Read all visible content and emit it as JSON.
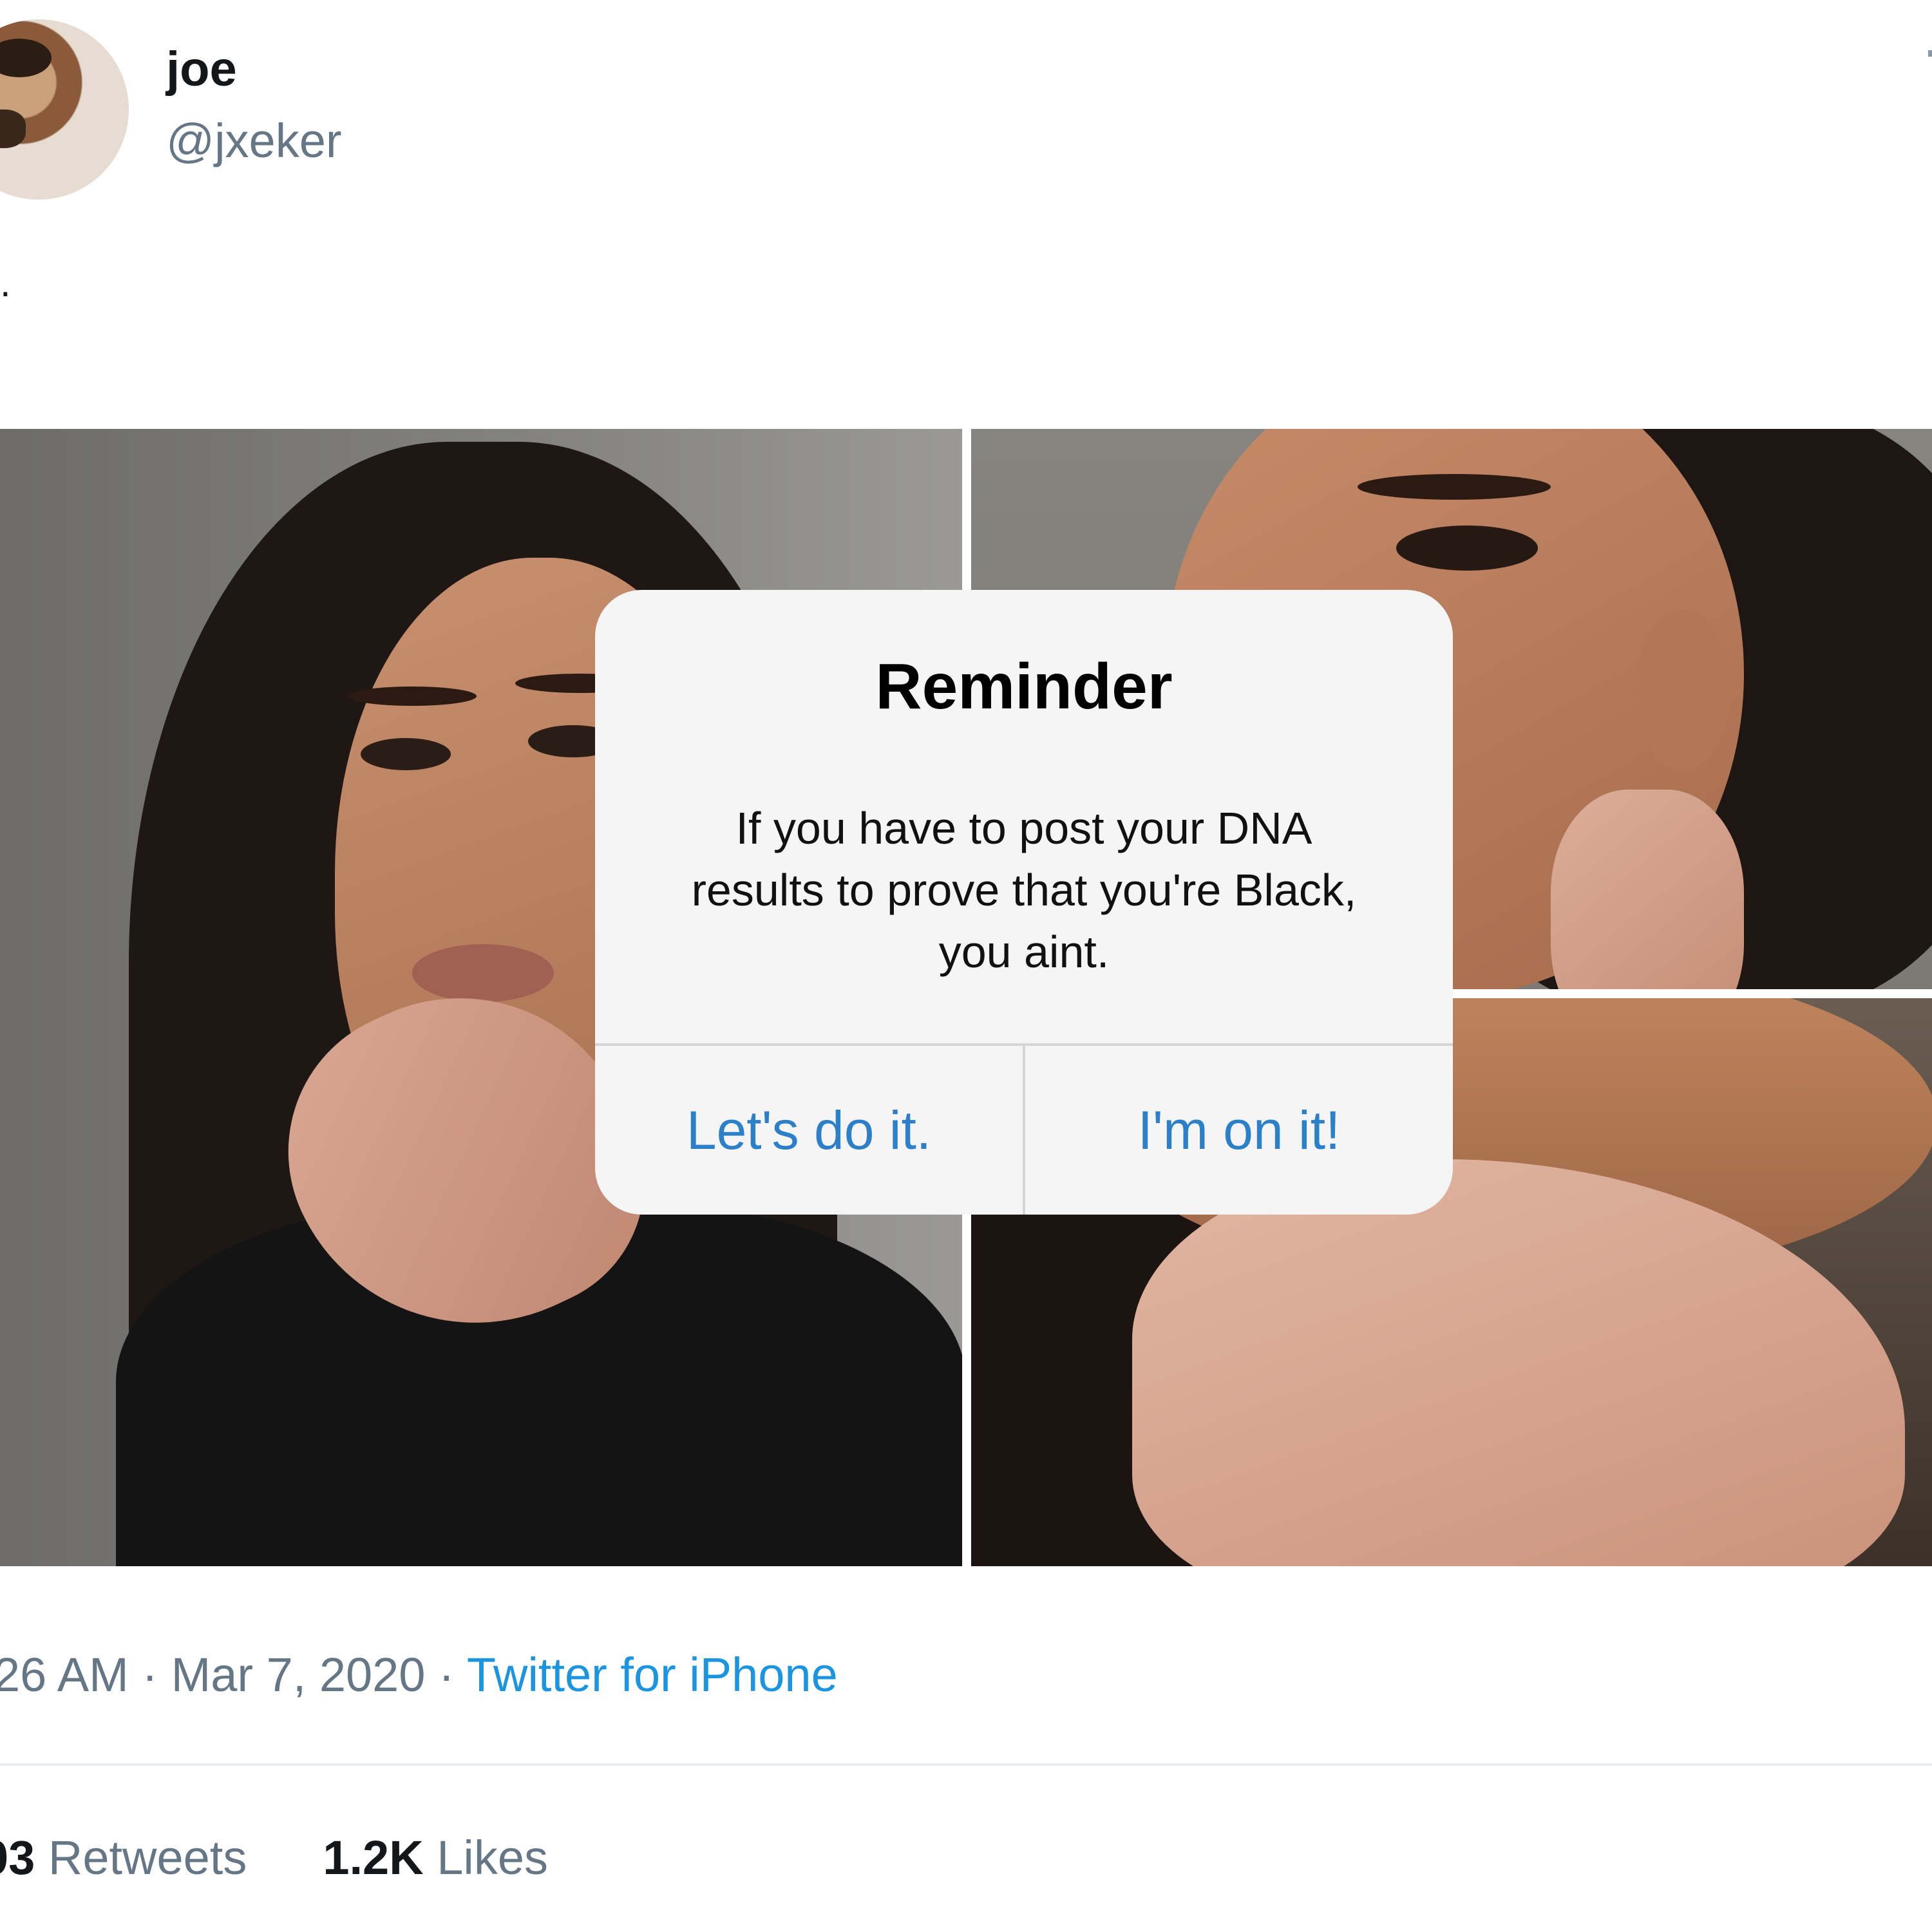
{
  "user": {
    "display_name": "joe",
    "handle": "@jxeker"
  },
  "tweet": {
    "text": "."
  },
  "alert": {
    "title": "Reminder",
    "message": "If you have to post your DNA results to prove that you're Black, you aint.",
    "button_left": "Let's do it.",
    "button_right": "I'm on it!"
  },
  "meta": {
    "time": "26 AM",
    "sep1": " · ",
    "date": "Mar 7, 2020",
    "sep2": " · ",
    "source": "Twitter for iPhone"
  },
  "stats": {
    "retweets_count": "03",
    "retweets_label": "Retweets",
    "likes_count": "1.2K",
    "likes_label": "Likes"
  },
  "colors": {
    "link": "#1b95e0",
    "alert_button": "#2c80c9",
    "secondary_text": "#657786"
  },
  "icons": {
    "avatar": "avatar-photo"
  }
}
